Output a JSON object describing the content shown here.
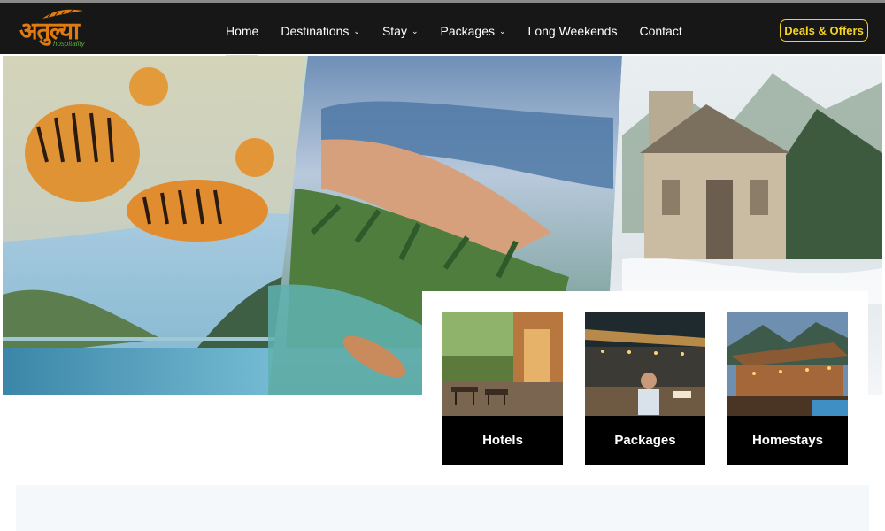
{
  "brand": {
    "logo_text": "अतुल्या",
    "logo_subtext": "hospitality",
    "colors": {
      "logo_orange": "#e07b12",
      "logo_green": "#5aa83a"
    }
  },
  "nav": {
    "items": [
      {
        "label": "Home",
        "active": true,
        "dropdown": false
      },
      {
        "label": "Destinations",
        "active": false,
        "dropdown": true
      },
      {
        "label": "Stay",
        "active": false,
        "dropdown": true
      },
      {
        "label": "Packages",
        "active": false,
        "dropdown": true
      },
      {
        "label": "Long Weekends",
        "active": false,
        "dropdown": false
      },
      {
        "label": "Contact",
        "active": false,
        "dropdown": false
      }
    ],
    "dropdown_icon": "chevron-down-icon",
    "deals_label": "Deals & Offers",
    "colors": {
      "bar": "#171717",
      "deals_accent": "#f3d224"
    }
  },
  "hero": {
    "panels": [
      "tigers-and-lake-painting",
      "beach-and-diver-painting",
      "mountain-temple-painting"
    ]
  },
  "categories": [
    {
      "label": "Hotels",
      "image": "hotel-terrace-photo"
    },
    {
      "label": "Packages",
      "image": "dining-deck-photo"
    },
    {
      "label": "Homestays",
      "image": "mountain-homestay-photo"
    }
  ]
}
